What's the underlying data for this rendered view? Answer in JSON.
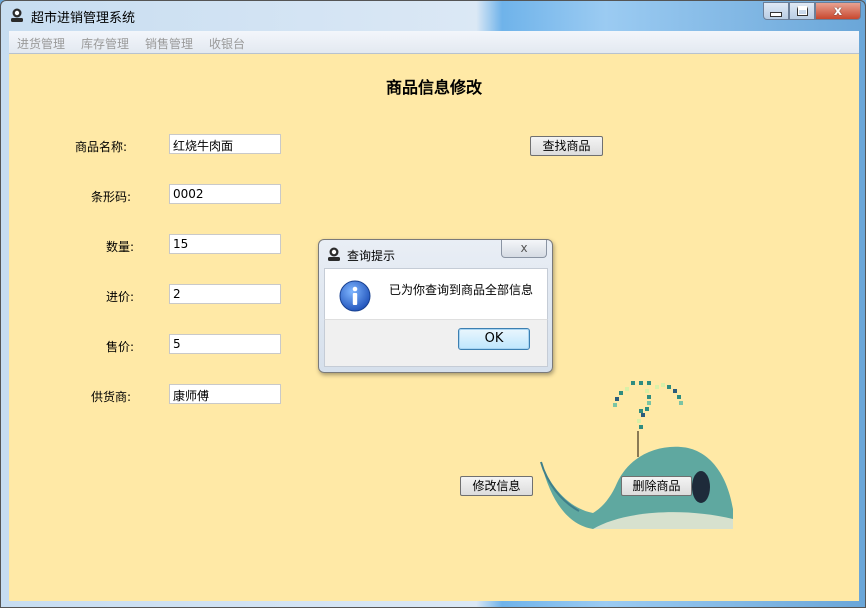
{
  "window": {
    "title": "超市进销管理系统",
    "minimize_icon": "minimize-icon",
    "maximize_icon": "maximize-icon",
    "close_icon": "close-icon",
    "close_glyph": "x"
  },
  "menu": {
    "items": [
      {
        "label": "进货管理"
      },
      {
        "label": "库存管理"
      },
      {
        "label": "销售管理"
      },
      {
        "label": "收银台"
      }
    ]
  },
  "form": {
    "title": "商品信息修改",
    "fields": [
      {
        "label": "商品名称:",
        "value": "红烧牛肉面"
      },
      {
        "label": "条形码:",
        "value": "0002"
      },
      {
        "label": "数量:",
        "value": "15"
      },
      {
        "label": "进价:",
        "value": "2"
      },
      {
        "label": "售价:",
        "value": "5"
      },
      {
        "label": "供货商:",
        "value": "康师傅"
      }
    ],
    "search_button": "查找商品",
    "modify_button": "修改信息",
    "delete_button": "删除商品"
  },
  "dialog": {
    "title": "查询提示",
    "message": "已为你查询到商品全部信息",
    "ok_button": "OK",
    "close_glyph": "x",
    "icon": "info-icon"
  },
  "colors": {
    "content_bg": "#ffe9a6",
    "menu_disabled_text": "#9a9a9a",
    "whale_body": "#5fa8a0"
  }
}
